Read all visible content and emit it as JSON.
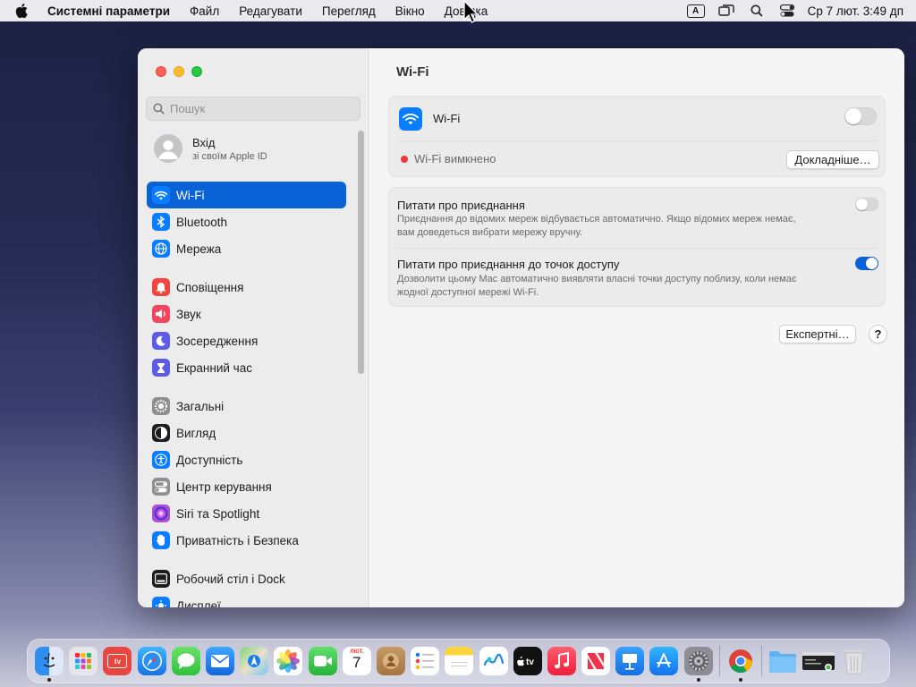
{
  "menubar": {
    "app_name": "Системні параметри",
    "menus": [
      "Файл",
      "Редагувати",
      "Перегляд",
      "Вікно",
      "Довідка"
    ],
    "input_source": "A",
    "clock": "Ср 7 лют.  3:49 дп"
  },
  "sidebar": {
    "search_placeholder": "Пошук",
    "account": {
      "title": "Вхід",
      "subtitle": "зі своїм Apple ID"
    },
    "items": [
      {
        "label": "Wi-Fi",
        "icon": "wifi-icon",
        "color": "#0a7cff"
      },
      {
        "label": "Bluetooth",
        "icon": "bluetooth-icon",
        "color": "#0a7cff"
      },
      {
        "label": "Мережа",
        "icon": "globe-icon",
        "color": "#0a7cff"
      },
      {
        "label": "Сповіщення",
        "icon": "bell-icon",
        "color": "#f2453d"
      },
      {
        "label": "Звук",
        "icon": "speaker-icon",
        "color": "#f2455f"
      },
      {
        "label": "Зосередження",
        "icon": "moon-icon",
        "color": "#5e5ce6"
      },
      {
        "label": "Екранний час",
        "icon": "hourglass-icon",
        "color": "#5e5ce6"
      },
      {
        "label": "Загальні",
        "icon": "gear-icon",
        "color": "#8e8e93"
      },
      {
        "label": "Вигляд",
        "icon": "appearance-icon",
        "color": "#1d1d1f"
      },
      {
        "label": "Доступність",
        "icon": "accessibility-icon",
        "color": "#0a7cff"
      },
      {
        "label": "Центр керування",
        "icon": "control-center-icon",
        "color": "#8e8e93"
      },
      {
        "label": "Siri та Spotlight",
        "icon": "siri-icon",
        "color": "#b04fd6"
      },
      {
        "label": "Приватність і Безпека",
        "icon": "hand-icon",
        "color": "#0a7cff"
      },
      {
        "label": "Робочий стіл і Dock",
        "icon": "dock-icon",
        "color": "#1d1d1f"
      },
      {
        "label": "Дисплеї",
        "icon": "display-icon",
        "color": "#0a7cff"
      }
    ],
    "selected": "Wi-Fi"
  },
  "main": {
    "title": "Wi-Fi",
    "wifi": {
      "label": "Wi-Fi",
      "enabled": false,
      "status": "Wi-Fi вимкнено",
      "details_button": "Докладніше…"
    },
    "ask_join": {
      "title": "Питати про приєднання",
      "description_line1": "Приєднання до відомих мереж відбувається автоматично. Якщо відомих мереж немає,",
      "description_line2": "вам доведеться вибрати мережу вручну.",
      "enabled": false
    },
    "ask_hotspot": {
      "title": "Питати про приєднання до точок доступу",
      "description_line1": "Дозволити цьому Mac автоматично виявляти власні точки доступу поблизу, коли немає",
      "description_line2": "жодної доступної мережі Wi-Fi.",
      "enabled": true
    },
    "advanced_button": "Експертні…",
    "help_button": "?"
  },
  "dock": {
    "calendar_month": "ЛЮТ.",
    "calendar_day": "7",
    "tv_label": "tv",
    "apps": [
      "finder",
      "launchpad",
      "tv-remote",
      "safari",
      "messages",
      "mail",
      "maps",
      "photos",
      "facetime",
      "calendar",
      "contacts",
      "reminders",
      "notes",
      "freeform",
      "apple-tv",
      "music",
      "news",
      "keynote",
      "app-store",
      "system-settings",
      "chrome",
      "downloads-folder",
      "terminal-window",
      "trash"
    ]
  }
}
